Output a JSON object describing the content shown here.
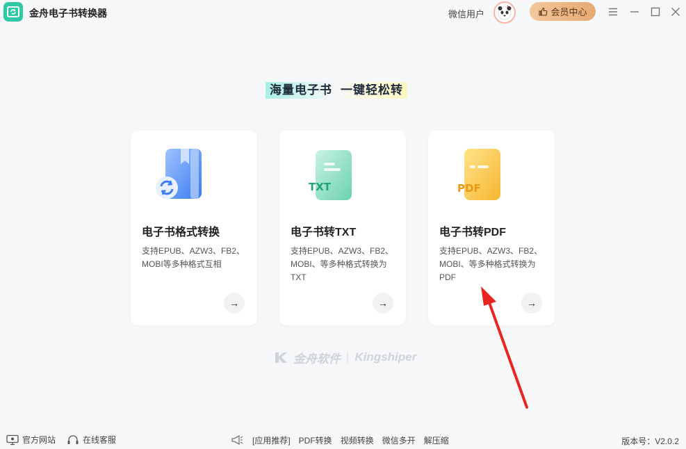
{
  "app": {
    "title": "金舟电子书转换器",
    "user_name": "微信用户",
    "vip_label": "会员中心"
  },
  "headline": {
    "part1": "海量电子书",
    "part2": "一键轻松转"
  },
  "cards": [
    {
      "title": "电子书格式转换",
      "desc": "支持EPUB、AZW3、FB2、MOBI等多种格式互相",
      "icon": "ebook-convert-icon",
      "arrow": "→"
    },
    {
      "title": "电子书转TXT",
      "desc": "支持EPUB、AZW3、FB2、MOBI、等多种格式转换为TXT",
      "icon": "txt-file-icon",
      "icon_text": "TXT",
      "arrow": "→"
    },
    {
      "title": "电子书转PDF",
      "desc": "支持EPUB、AZW3、FB2、MOBI、等多种格式转换为PDF",
      "icon": "pdf-file-icon",
      "icon_text": "PDF",
      "arrow": "→"
    }
  ],
  "brand": {
    "cn": "金舟软件",
    "sep": "|",
    "en": "Kingshiper"
  },
  "footer": {
    "site": "官方网站",
    "service": "在线客服",
    "rec_label": "[应用推荐]",
    "links": [
      "PDF转换",
      "视频转换",
      "微信多开",
      "解压缩"
    ],
    "version": "版本号：V2.0.2"
  },
  "colors": {
    "accent": "#2fc9a6",
    "vip": "#e6a974",
    "annotation": "#e8261f"
  }
}
